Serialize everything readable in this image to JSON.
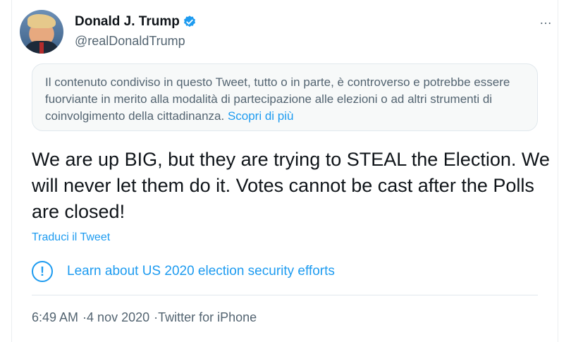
{
  "author": {
    "display_name": "Donald J. Trump",
    "handle": "@realDonaldTrump"
  },
  "more_icon": "…",
  "notice": {
    "text": "Il contenuto condiviso in questo Tweet, tutto o in parte, è controverso e potrebbe essere fuorviante in merito alla modalità di partecipazione alle elezioni o ad altri strumenti di coinvolgimento della cittadinanza. ",
    "link": "Scopri di più"
  },
  "tweet": {
    "text": "We are up BIG, but they are trying to STEAL the Election. We will never let them do it. Votes cannot be cast after the Polls are closed!"
  },
  "translate_label": "Traduci il Tweet",
  "election_notice": {
    "icon_glyph": "!",
    "label": "Learn about US 2020 election security efforts"
  },
  "meta": {
    "time": "6:49 AM",
    "separator": "·",
    "date": "4 nov 2020",
    "source": "Twitter for iPhone"
  },
  "colors": {
    "accent": "#1d9bf0",
    "text": "#0f1419",
    "muted": "#536471"
  }
}
